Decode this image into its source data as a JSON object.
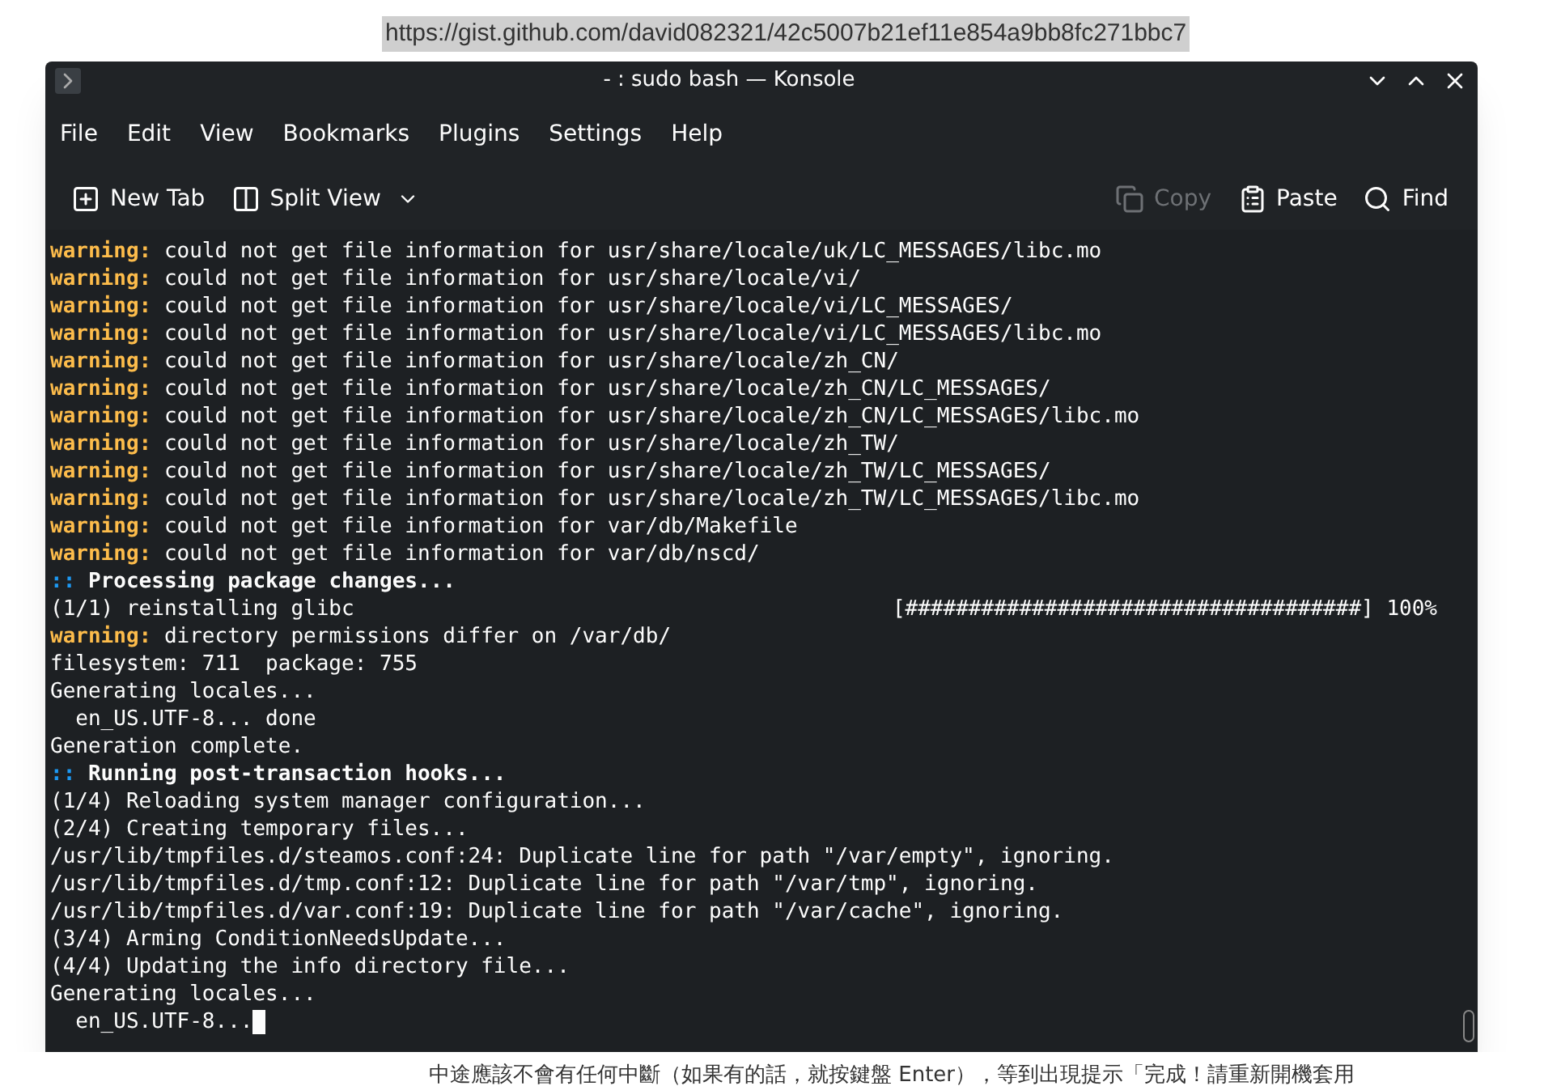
{
  "page": {
    "url": "https://gist.github.com/david082321/42c5007b21ef11e854a9bb8fc271bbc7",
    "footer_text": "中途應該不會有任何中斷（如果有的話，就按鍵盤 Enter），等到出現提示「完成！請重新開機套用"
  },
  "window": {
    "title": "- : sudo bash — Konsole"
  },
  "menu": [
    "File",
    "Edit",
    "View",
    "Bookmarks",
    "Plugins",
    "Settings",
    "Help"
  ],
  "toolbar_left": [
    {
      "label": "New Tab",
      "kind": "newtab"
    },
    {
      "label": "Split View",
      "kind": "split"
    }
  ],
  "toolbar_right": [
    {
      "label": "Copy",
      "kind": "copy",
      "disabled": true
    },
    {
      "label": "Paste",
      "kind": "paste",
      "disabled": false
    },
    {
      "label": "Find",
      "kind": "find",
      "disabled": false
    }
  ],
  "lines": [
    {
      "kind": "warning",
      "prefix": "warning:",
      "text": " could not get file information for usr/share/locale/uk/LC_MESSAGES/libc.mo"
    },
    {
      "kind": "warning",
      "prefix": "warning:",
      "text": " could not get file information for usr/share/locale/vi/"
    },
    {
      "kind": "warning",
      "prefix": "warning:",
      "text": " could not get file information for usr/share/locale/vi/LC_MESSAGES/"
    },
    {
      "kind": "warning",
      "prefix": "warning:",
      "text": " could not get file information for usr/share/locale/vi/LC_MESSAGES/libc.mo"
    },
    {
      "kind": "warning",
      "prefix": "warning:",
      "text": " could not get file information for usr/share/locale/zh_CN/"
    },
    {
      "kind": "warning",
      "prefix": "warning:",
      "text": " could not get file information for usr/share/locale/zh_CN/LC_MESSAGES/"
    },
    {
      "kind": "warning",
      "prefix": "warning:",
      "text": " could not get file information for usr/share/locale/zh_CN/LC_MESSAGES/libc.mo"
    },
    {
      "kind": "warning",
      "prefix": "warning:",
      "text": " could not get file information for usr/share/locale/zh_TW/"
    },
    {
      "kind": "warning",
      "prefix": "warning:",
      "text": " could not get file information for usr/share/locale/zh_TW/LC_MESSAGES/"
    },
    {
      "kind": "warning",
      "prefix": "warning:",
      "text": " could not get file information for usr/share/locale/zh_TW/LC_MESSAGES/libc.mo"
    },
    {
      "kind": "warning",
      "prefix": "warning:",
      "text": " could not get file information for var/db/Makefile"
    },
    {
      "kind": "warning",
      "prefix": "warning:",
      "text": " could not get file information for var/db/nscd/"
    },
    {
      "kind": "section",
      "prefix": "::",
      "text": " Processing package changes..."
    },
    {
      "kind": "progress",
      "text": "(1/1) reinstalling glibc",
      "bar": "[####################################] 100%"
    },
    {
      "kind": "warning",
      "prefix": "warning:",
      "text": " directory permissions differ on /var/db/"
    },
    {
      "kind": "plain",
      "text": "filesystem: 711  package: 755"
    },
    {
      "kind": "plain",
      "text": "Generating locales..."
    },
    {
      "kind": "plain",
      "text": "  en_US.UTF-8... done"
    },
    {
      "kind": "plain",
      "text": "Generation complete."
    },
    {
      "kind": "section",
      "prefix": "::",
      "text": " Running post-transaction hooks..."
    },
    {
      "kind": "plain",
      "text": "(1/4) Reloading system manager configuration..."
    },
    {
      "kind": "plain",
      "text": "(2/4) Creating temporary files..."
    },
    {
      "kind": "plain",
      "text": "/usr/lib/tmpfiles.d/steamos.conf:24: Duplicate line for path \"/var/empty\", ignoring."
    },
    {
      "kind": "plain",
      "text": "/usr/lib/tmpfiles.d/tmp.conf:12: Duplicate line for path \"/var/tmp\", ignoring."
    },
    {
      "kind": "plain",
      "text": "/usr/lib/tmpfiles.d/var.conf:19: Duplicate line for path \"/var/cache\", ignoring."
    },
    {
      "kind": "plain",
      "text": "(3/4) Arming ConditionNeedsUpdate..."
    },
    {
      "kind": "plain",
      "text": "(4/4) Updating the info directory file..."
    },
    {
      "kind": "plain",
      "text": "Generating locales..."
    },
    {
      "kind": "cursor",
      "text": "  en_US.UTF-8..."
    }
  ]
}
